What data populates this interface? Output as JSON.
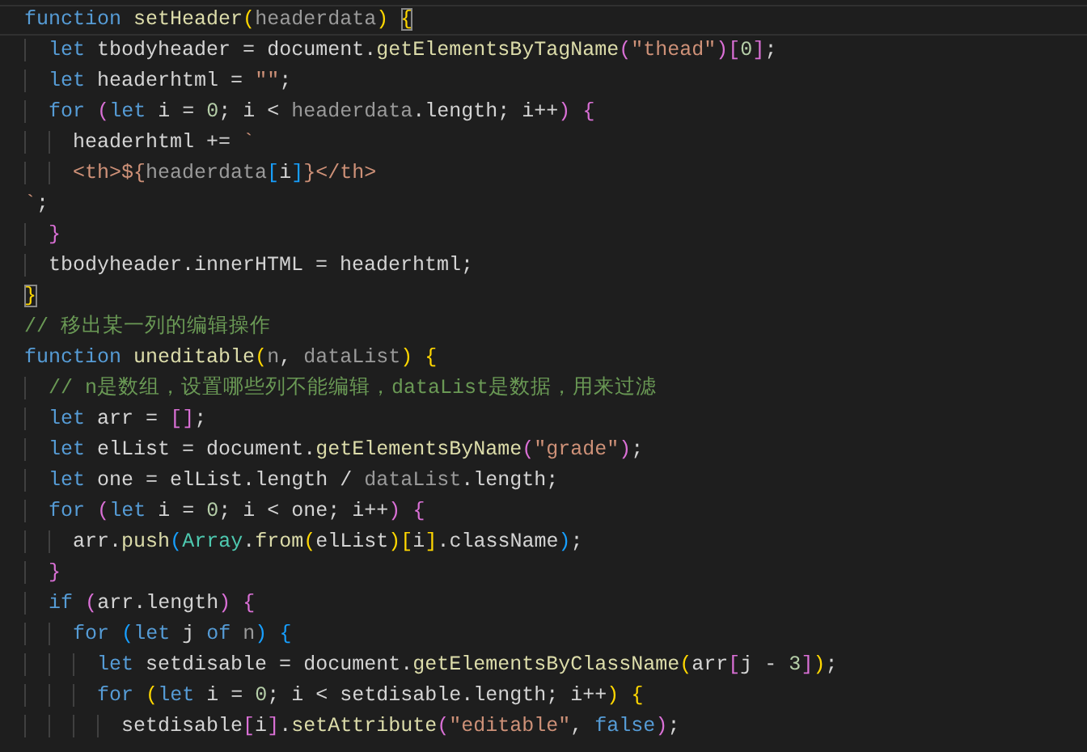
{
  "editor": {
    "lines": [
      {
        "current": true,
        "tokens": [
          {
            "kind": "kw",
            "text": "function"
          },
          {
            "kind": "fn",
            "text": " setHeader"
          },
          {
            "kind": "br1",
            "text": "("
          },
          {
            "kind": "param",
            "text": "headerdata"
          },
          {
            "kind": "br1",
            "text": ")"
          },
          {
            "kind": "br1",
            "text": " {",
            "matched": true
          }
        ]
      },
      {
        "current": false,
        "tokens": [
          {
            "kind": "kw",
            "text": "  let"
          },
          {
            "kind": "plain",
            "text": " tbodyheader = document."
          },
          {
            "kind": "fn",
            "text": "getElementsByTagName"
          },
          {
            "kind": "br2",
            "text": "("
          },
          {
            "kind": "str",
            "text": "\"thead\""
          },
          {
            "kind": "br2",
            "text": ")"
          },
          {
            "kind": "br2",
            "text": "["
          },
          {
            "kind": "num",
            "text": "0"
          },
          {
            "kind": "br2",
            "text": "]"
          },
          {
            "kind": "plain",
            "text": ";"
          }
        ]
      },
      {
        "current": false,
        "tokens": [
          {
            "kind": "kw",
            "text": "  let"
          },
          {
            "kind": "plain",
            "text": " headerhtml = "
          },
          {
            "kind": "str",
            "text": "\"\""
          },
          {
            "kind": "plain",
            "text": ";"
          }
        ]
      },
      {
        "current": false,
        "tokens": [
          {
            "kind": "kw",
            "text": "  for"
          },
          {
            "kind": "br2",
            "text": " ("
          },
          {
            "kind": "kw",
            "text": "let"
          },
          {
            "kind": "plain",
            "text": " i = "
          },
          {
            "kind": "num",
            "text": "0"
          },
          {
            "kind": "plain",
            "text": "; i < "
          },
          {
            "kind": "param",
            "text": "headerdata"
          },
          {
            "kind": "plain",
            "text": ".length; i++"
          },
          {
            "kind": "br2",
            "text": ")"
          },
          {
            "kind": "br2",
            "text": " {"
          }
        ]
      },
      {
        "current": false,
        "tokens": [
          {
            "kind": "plain",
            "text": "    headerhtml += "
          },
          {
            "kind": "str",
            "text": "`"
          }
        ]
      },
      {
        "current": false,
        "tokens": [
          {
            "kind": "str",
            "text": "    <th>${"
          },
          {
            "kind": "param",
            "text": "headerdata"
          },
          {
            "kind": "br3",
            "text": "["
          },
          {
            "kind": "plain",
            "text": "i"
          },
          {
            "kind": "br3",
            "text": "]"
          },
          {
            "kind": "str",
            "text": "}</th>"
          }
        ]
      },
      {
        "current": false,
        "tokens": [
          {
            "kind": "str",
            "text": "`"
          },
          {
            "kind": "plain",
            "text": ";"
          }
        ]
      },
      {
        "current": false,
        "tokens": [
          {
            "kind": "br2",
            "text": "  }"
          }
        ]
      },
      {
        "current": false,
        "tokens": [
          {
            "kind": "plain",
            "text": "  tbodyheader.innerHTML = headerhtml;"
          }
        ]
      },
      {
        "current": false,
        "tokens": [
          {
            "kind": "br1",
            "text": "}",
            "matched": true
          }
        ]
      },
      {
        "current": false,
        "tokens": [
          {
            "kind": "cmt",
            "text": "// 移出某一列的编辑操作"
          }
        ]
      },
      {
        "current": false,
        "tokens": [
          {
            "kind": "kw",
            "text": "function"
          },
          {
            "kind": "fn",
            "text": " uneditable"
          },
          {
            "kind": "br1",
            "text": "("
          },
          {
            "kind": "param",
            "text": "n"
          },
          {
            "kind": "plain",
            "text": ","
          },
          {
            "kind": "param",
            "text": " dataList"
          },
          {
            "kind": "br1",
            "text": ")"
          },
          {
            "kind": "br1",
            "text": " {"
          }
        ]
      },
      {
        "current": false,
        "tokens": [
          {
            "kind": "cmt",
            "text": "  // n是数组，设置哪些列不能编辑，dataList是数据，用来过滤"
          }
        ]
      },
      {
        "current": false,
        "tokens": [
          {
            "kind": "kw",
            "text": "  let"
          },
          {
            "kind": "plain",
            "text": " arr = "
          },
          {
            "kind": "br2",
            "text": "["
          },
          {
            "kind": "br2",
            "text": "]"
          },
          {
            "kind": "plain",
            "text": ";"
          }
        ]
      },
      {
        "current": false,
        "tokens": [
          {
            "kind": "kw",
            "text": "  let"
          },
          {
            "kind": "plain",
            "text": " elList = document."
          },
          {
            "kind": "fn",
            "text": "getElementsByName"
          },
          {
            "kind": "br2",
            "text": "("
          },
          {
            "kind": "str",
            "text": "\"grade\""
          },
          {
            "kind": "br2",
            "text": ")"
          },
          {
            "kind": "plain",
            "text": ";"
          }
        ]
      },
      {
        "current": false,
        "tokens": [
          {
            "kind": "kw",
            "text": "  let"
          },
          {
            "kind": "plain",
            "text": " one = elList.length / "
          },
          {
            "kind": "param",
            "text": "dataList"
          },
          {
            "kind": "plain",
            "text": ".length;"
          }
        ]
      },
      {
        "current": false,
        "tokens": [
          {
            "kind": "kw",
            "text": "  for"
          },
          {
            "kind": "br2",
            "text": " ("
          },
          {
            "kind": "kw",
            "text": "let"
          },
          {
            "kind": "plain",
            "text": " i = "
          },
          {
            "kind": "num",
            "text": "0"
          },
          {
            "kind": "plain",
            "text": "; i < one; i++"
          },
          {
            "kind": "br2",
            "text": ")"
          },
          {
            "kind": "br2",
            "text": " {"
          }
        ]
      },
      {
        "current": false,
        "tokens": [
          {
            "kind": "plain",
            "text": "    arr."
          },
          {
            "kind": "fn",
            "text": "push"
          },
          {
            "kind": "br3",
            "text": "("
          },
          {
            "kind": "cls",
            "text": "Array"
          },
          {
            "kind": "plain",
            "text": "."
          },
          {
            "kind": "fn",
            "text": "from"
          },
          {
            "kind": "br1",
            "text": "("
          },
          {
            "kind": "plain",
            "text": "elList"
          },
          {
            "kind": "br1",
            "text": ")"
          },
          {
            "kind": "br1",
            "text": "["
          },
          {
            "kind": "plain",
            "text": "i"
          },
          {
            "kind": "br1",
            "text": "]"
          },
          {
            "kind": "plain",
            "text": ".className"
          },
          {
            "kind": "br3",
            "text": ")"
          },
          {
            "kind": "plain",
            "text": ";"
          }
        ]
      },
      {
        "current": false,
        "tokens": [
          {
            "kind": "br2",
            "text": "  }"
          }
        ]
      },
      {
        "current": false,
        "tokens": [
          {
            "kind": "kw",
            "text": "  if"
          },
          {
            "kind": "br2",
            "text": " ("
          },
          {
            "kind": "plain",
            "text": "arr.length"
          },
          {
            "kind": "br2",
            "text": ")"
          },
          {
            "kind": "br2",
            "text": " {"
          }
        ]
      },
      {
        "current": false,
        "tokens": [
          {
            "kind": "kw",
            "text": "    for"
          },
          {
            "kind": "br3",
            "text": " ("
          },
          {
            "kind": "kw",
            "text": "let"
          },
          {
            "kind": "plain",
            "text": " j"
          },
          {
            "kind": "kw",
            "text": " of"
          },
          {
            "kind": "param",
            "text": " n"
          },
          {
            "kind": "br3",
            "text": ")"
          },
          {
            "kind": "br3",
            "text": " {"
          }
        ]
      },
      {
        "current": false,
        "tokens": [
          {
            "kind": "kw",
            "text": "      let"
          },
          {
            "kind": "plain",
            "text": " setdisable = document."
          },
          {
            "kind": "fn",
            "text": "getElementsByClassName"
          },
          {
            "kind": "br1",
            "text": "("
          },
          {
            "kind": "plain",
            "text": "arr"
          },
          {
            "kind": "br2",
            "text": "["
          },
          {
            "kind": "plain",
            "text": "j - "
          },
          {
            "kind": "num",
            "text": "3"
          },
          {
            "kind": "br2",
            "text": "]"
          },
          {
            "kind": "br1",
            "text": ")"
          },
          {
            "kind": "plain",
            "text": ";"
          }
        ]
      },
      {
        "current": false,
        "tokens": [
          {
            "kind": "kw",
            "text": "      for"
          },
          {
            "kind": "br1",
            "text": " ("
          },
          {
            "kind": "kw",
            "text": "let"
          },
          {
            "kind": "plain",
            "text": " i = "
          },
          {
            "kind": "num",
            "text": "0"
          },
          {
            "kind": "plain",
            "text": "; i < setdisable.length; i++"
          },
          {
            "kind": "br1",
            "text": ")"
          },
          {
            "kind": "br1",
            "text": " {"
          }
        ]
      },
      {
        "current": false,
        "tokens": [
          {
            "kind": "plain",
            "text": "        setdisable"
          },
          {
            "kind": "br2",
            "text": "["
          },
          {
            "kind": "plain",
            "text": "i"
          },
          {
            "kind": "br2",
            "text": "]"
          },
          {
            "kind": "plain",
            "text": "."
          },
          {
            "kind": "fn",
            "text": "setAttribute"
          },
          {
            "kind": "br2",
            "text": "("
          },
          {
            "kind": "str",
            "text": "\"editable\""
          },
          {
            "kind": "plain",
            "text": ","
          },
          {
            "kind": "kw",
            "text": " false"
          },
          {
            "kind": "br2",
            "text": ")"
          },
          {
            "kind": "plain",
            "text": ";"
          }
        ]
      }
    ]
  }
}
